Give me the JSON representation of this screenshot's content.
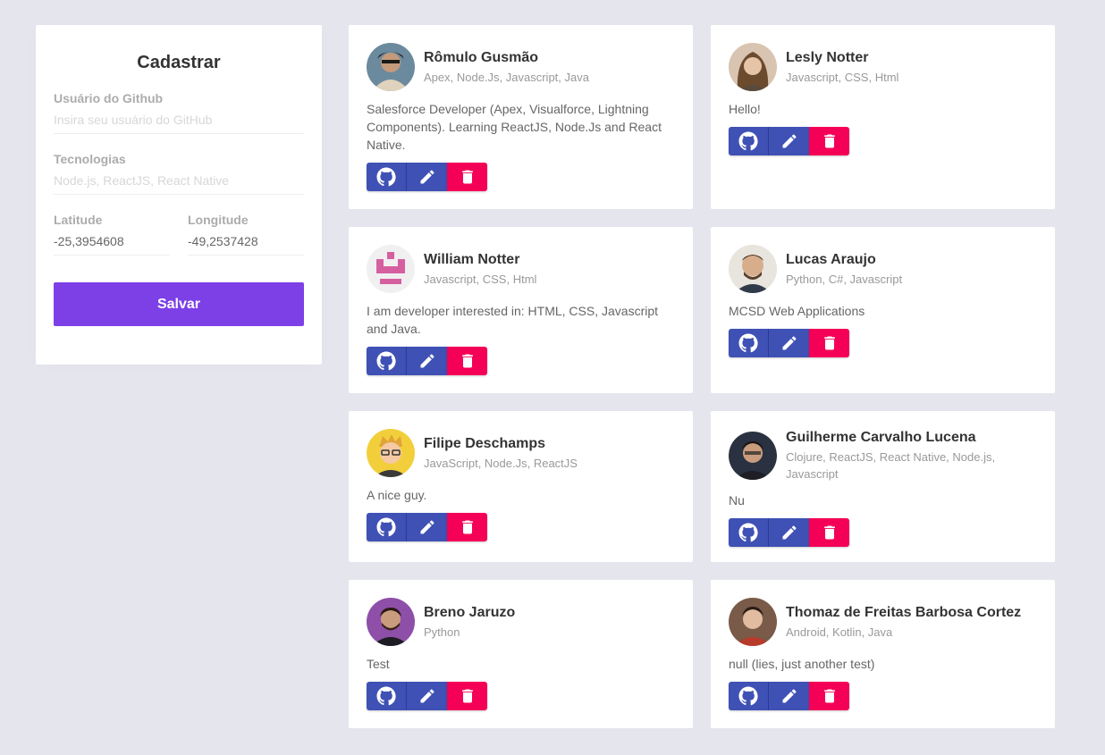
{
  "form": {
    "title": "Cadastrar",
    "github_label": "Usuário do Github",
    "github_placeholder": "Insira seu usuário do GitHub",
    "techs_label": "Tecnologias",
    "techs_placeholder": "Node.js, ReactJS, React Native",
    "latitude_label": "Latitude",
    "latitude_value": "-25,3954608",
    "longitude_label": "Longitude",
    "longitude_value": "-49,2537428",
    "save_label": "Salvar",
    "accent_color": "#7d40e7"
  },
  "devs": [
    {
      "name": "Rômulo Gusmão",
      "techs": "Apex, Node.Js, Javascript, Java",
      "bio": "Salesforce Developer (Apex, Visualforce, Lightning Components). Learning ReactJS, Node.Js and React Native.",
      "avatar_icon": "avatar-photo"
    },
    {
      "name": "Lesly Notter",
      "techs": "Javascript, CSS, Html",
      "bio": "Hello!",
      "avatar_icon": "avatar-photo"
    },
    {
      "name": "William Notter",
      "techs": "Javascript, CSS, Html",
      "bio": "I am developer interested in: HTML, CSS, Javascript and Java.",
      "avatar_icon": "identicon"
    },
    {
      "name": "Lucas Araujo",
      "techs": "Python, C#, Javascript",
      "bio": "MCSD Web Applications",
      "avatar_icon": "avatar-photo"
    },
    {
      "name": "Filipe Deschamps",
      "techs": "JavaScript, Node.Js, ReactJS",
      "bio": "A nice guy.",
      "avatar_icon": "avatar-cartoon"
    },
    {
      "name": "Guilherme Carvalho Lucena",
      "techs": "Clojure, ReactJS, React Native, Node.js, Javascript",
      "bio": "Nu",
      "avatar_icon": "avatar-photo"
    },
    {
      "name": "Breno Jaruzo",
      "techs": "Python",
      "bio": "Test",
      "avatar_icon": "avatar-photo"
    },
    {
      "name": "Thomaz de Freitas Barbosa Cortez",
      "techs": "Android, Kotlin, Java",
      "bio": "null (lies, just another test)",
      "avatar_icon": "avatar-photo"
    }
  ],
  "colors": {
    "page_bg": "#e5e5ee",
    "action_primary": "#3f51b5",
    "action_delete": "#f50057"
  },
  "action_icons": [
    "github-icon",
    "pencil-icon",
    "trash-icon"
  ]
}
